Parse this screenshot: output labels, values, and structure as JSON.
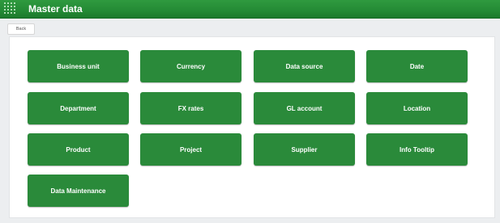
{
  "header": {
    "title": "Master data",
    "icon": "grid-dots-icon"
  },
  "toolbar": {
    "back_label": "Back"
  },
  "tiles": [
    {
      "label": "Business unit"
    },
    {
      "label": "Currency"
    },
    {
      "label": "Data source"
    },
    {
      "label": "Date"
    },
    {
      "label": "Department"
    },
    {
      "label": "FX rates"
    },
    {
      "label": "GL account"
    },
    {
      "label": "Location"
    },
    {
      "label": "Product"
    },
    {
      "label": "Project"
    },
    {
      "label": "Supplier"
    },
    {
      "label": "Info Tooltip"
    },
    {
      "label": "Data Maintenance"
    }
  ],
  "colors": {
    "header_green": "#248a35",
    "tile_green": "#2a8a3a",
    "background": "#eceef0"
  }
}
